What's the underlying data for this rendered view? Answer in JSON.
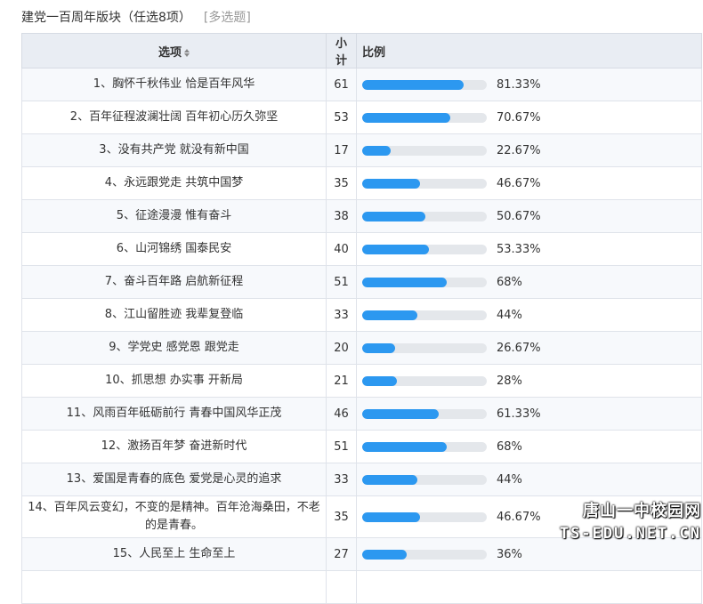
{
  "question": {
    "title": "建党一百周年版块（任选8项）",
    "type": "[多选题]"
  },
  "table": {
    "headers": {
      "option": "选项",
      "count": "小计",
      "ratio": "比例"
    },
    "rows": [
      {
        "option": "1、胸怀千秋伟业 恰是百年风华",
        "count": "61",
        "percent_label": "81.33%",
        "percent": 81.33
      },
      {
        "option": "2、百年征程波澜壮阔 百年初心历久弥坚",
        "count": "53",
        "percent_label": "70.67%",
        "percent": 70.67
      },
      {
        "option": "3、没有共产党 就没有新中国",
        "count": "17",
        "percent_label": "22.67%",
        "percent": 22.67
      },
      {
        "option": "4、永远跟党走 共筑中国梦",
        "count": "35",
        "percent_label": "46.67%",
        "percent": 46.67
      },
      {
        "option": "5、征途漫漫 惟有奋斗",
        "count": "38",
        "percent_label": "50.67%",
        "percent": 50.67
      },
      {
        "option": "6、山河锦绣 国泰民安",
        "count": "40",
        "percent_label": "53.33%",
        "percent": 53.33
      },
      {
        "option": "7、奋斗百年路 启航新征程",
        "count": "51",
        "percent_label": "68%",
        "percent": 68
      },
      {
        "option": "8、江山留胜迹 我辈复登临",
        "count": "33",
        "percent_label": "44%",
        "percent": 44
      },
      {
        "option": "9、学党史 感党恩 跟党走",
        "count": "20",
        "percent_label": "26.67%",
        "percent": 26.67
      },
      {
        "option": "10、抓思想 办实事 开新局",
        "count": "21",
        "percent_label": "28%",
        "percent": 28
      },
      {
        "option": "11、风雨百年砥砺前行 青春中国风华正茂",
        "count": "46",
        "percent_label": "61.33%",
        "percent": 61.33
      },
      {
        "option": "12、激扬百年梦 奋进新时代",
        "count": "51",
        "percent_label": "68%",
        "percent": 68
      },
      {
        "option": "13、爱国是青春的底色 爱党是心灵的追求",
        "count": "33",
        "percent_label": "44%",
        "percent": 44
      },
      {
        "option": "14、百年风云变幻，不变的是精神。百年沧海桑田，不老的是青春。",
        "count": "35",
        "percent_label": "46.67%",
        "percent": 46.67
      },
      {
        "option": "15、人民至上 生命至上",
        "count": "27",
        "percent_label": "36%",
        "percent": 36
      },
      {
        "option": "",
        "count": "",
        "percent_label": "",
        "percent": 0
      }
    ]
  },
  "watermark": {
    "cn": "唐山一中校园网",
    "en": "TS-EDU.NET.CN"
  },
  "colors": {
    "bar_fill": "#2c98f0",
    "bar_track": "#e4e7eb",
    "header_bg": "#e9edf3"
  }
}
